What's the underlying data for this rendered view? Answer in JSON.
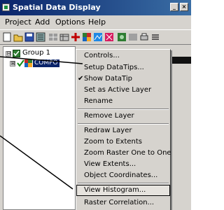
{
  "window": {
    "title": "Spatial Data Display"
  },
  "menubar": {
    "items": [
      "Project",
      "Add",
      "Options",
      "Help"
    ]
  },
  "tree": {
    "group_label": "Group 1",
    "layer_label": "COMPO",
    "group_expander": "⊟",
    "layer_expander": "⊞"
  },
  "context_menu": {
    "items": [
      {
        "label": "Controls...",
        "checked": false
      },
      {
        "label": "Setup DataTips...",
        "checked": false
      },
      {
        "label": "Show DataTip",
        "checked": true
      },
      {
        "label": "Set as Active Layer",
        "checked": false
      },
      {
        "label": "Rename",
        "checked": false
      },
      {
        "label": "Remove Layer",
        "checked": false
      },
      {
        "label": "Redraw Layer",
        "checked": false
      },
      {
        "label": "Zoom to Extents",
        "checked": false
      },
      {
        "label": "Zoom Raster One to One",
        "checked": false
      },
      {
        "label": "View Extents...",
        "checked": false
      },
      {
        "label": "Object Coordinates...",
        "checked": false
      },
      {
        "label": "View Histogram...",
        "checked": false
      },
      {
        "label": "Raster Correlation...",
        "checked": false
      }
    ],
    "check_mark": "✔",
    "highlighted_item": "View Histogram..."
  },
  "colors": {
    "title_start": "#0a246a",
    "title_end": "#3a6ea5",
    "face": "#d6d3ce",
    "selection": "#0a246a"
  }
}
